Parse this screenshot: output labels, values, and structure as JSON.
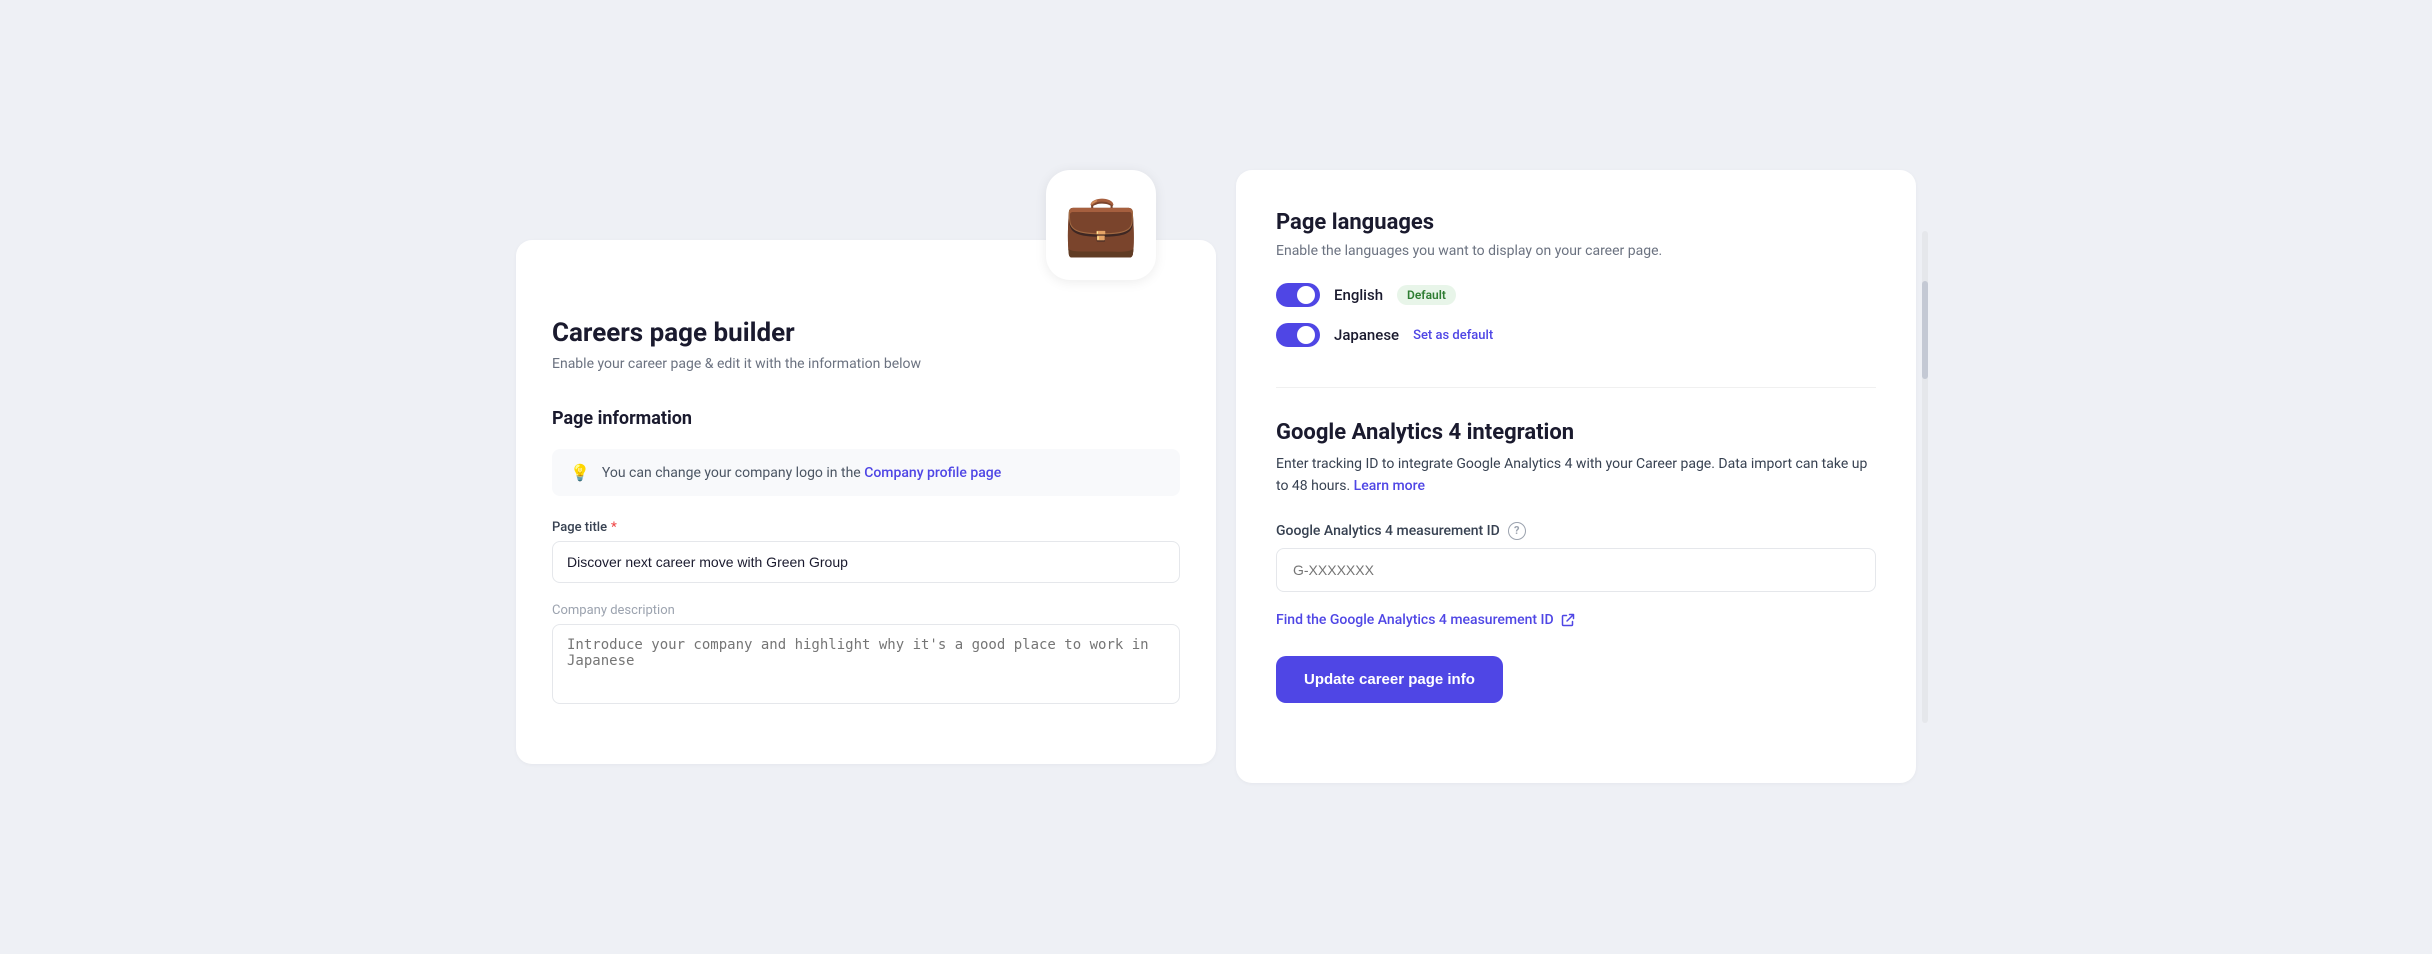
{
  "left": {
    "icon_emoji": "💼",
    "title": "Careers page builder",
    "subtitle": "Enable your career page & edit it with the information below",
    "page_information": {
      "heading": "Page information",
      "info_banner": {
        "text": "You can change your company logo in the",
        "link_text": "Company profile page"
      },
      "page_title_label": "Page title",
      "page_title_value": "Discover next career move with Green Group",
      "company_description_label": "Company description",
      "company_description_placeholder": "Introduce your company and highlight why it's a good place to work in Japanese"
    }
  },
  "right": {
    "page_languages": {
      "heading": "Page languages",
      "description": "Enable the languages you want to display on your career page.",
      "languages": [
        {
          "name": "English",
          "badge": "Default",
          "enabled": true
        },
        {
          "name": "Japanese",
          "set_default_text": "Set as default",
          "enabled": true
        }
      ]
    },
    "ga4": {
      "heading": "Google Analytics 4 integration",
      "description": "Enter tracking ID to integrate Google Analytics 4 with your Career page. Data import can take up to 48 hours.",
      "learn_more_text": "Learn more",
      "measurement_id_label": "Google Analytics 4 measurement ID",
      "measurement_id_placeholder": "G-XXXXXXX",
      "find_link_text": "Find the Google Analytics 4 measurement ID",
      "update_button_label": "Update career page info"
    }
  }
}
